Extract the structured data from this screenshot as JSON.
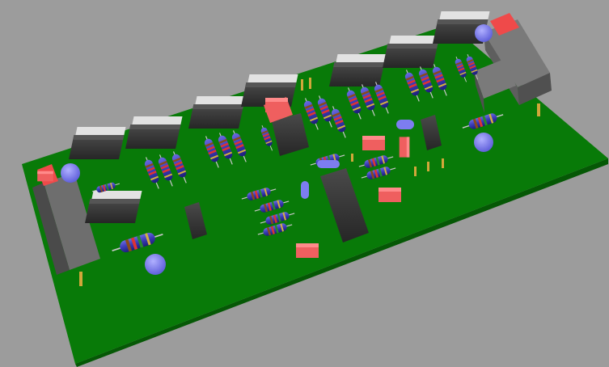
{
  "scene": {
    "background_color": "#9c9c9c",
    "board_color": "#087a08",
    "board_edge_color": "#055805",
    "resistor_body_color": "#3a3ab6",
    "chip_color": "#3a3a3a",
    "transistor_body_color": "#2c2c2c",
    "heatsink_tab_color": "#d9d9d9",
    "capacitor_color": "#7d7df0",
    "film_cap_color": "#ef5f5f",
    "connector_block_color": "#5d5d5d",
    "connector_top_color": "#ef4a4a",
    "pin_color": "#d2a73a"
  }
}
